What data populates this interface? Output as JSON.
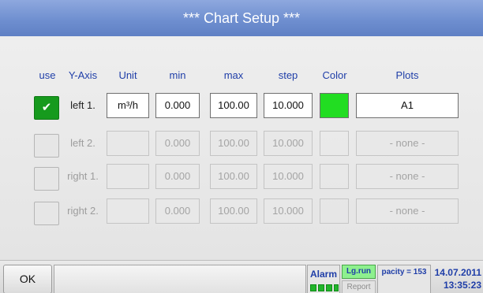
{
  "title": "***  Chart Setup  ***",
  "headers": {
    "use": "use",
    "y_axis": "Y-Axis",
    "unit": "Unit",
    "min": "min",
    "max": "max",
    "step": "step",
    "color": "Color",
    "plots": "Plots"
  },
  "rows": [
    {
      "checked": true,
      "check_mark": "✔",
      "axis": "left 1.",
      "unit": "m³/h",
      "min": "0.000",
      "max": "100.00",
      "step": "10.000",
      "color": "#22dd22",
      "plot": "A1",
      "enabled": true
    },
    {
      "checked": false,
      "check_mark": "",
      "axis": "left 2.",
      "unit": "",
      "min": "0.000",
      "max": "100.00",
      "step": "10.000",
      "color": "",
      "plot": "- none -",
      "enabled": false
    },
    {
      "checked": false,
      "check_mark": "",
      "axis": "right 1.",
      "unit": "",
      "min": "0.000",
      "max": "100.00",
      "step": "10.000",
      "color": "",
      "plot": "- none -",
      "enabled": false
    },
    {
      "checked": false,
      "check_mark": "",
      "axis": "right 2.",
      "unit": "",
      "min": "0.000",
      "max": "100.00",
      "step": "10.000",
      "color": "",
      "plot": "- none -",
      "enabled": false
    }
  ],
  "footer": {
    "ok_label": "OK",
    "alarm_label": "Alarm",
    "lgrun_label": "Lg.run",
    "report_label": "Report",
    "capacity_label": "pacity = 153",
    "date": "14.07.2011",
    "time": "13:35:23"
  },
  "colors": {
    "title_bar": "#6f8fd0",
    "check_on": "#169a1d",
    "header_text": "#1f3ea8",
    "lgrun_bg": "#8ef08e"
  }
}
